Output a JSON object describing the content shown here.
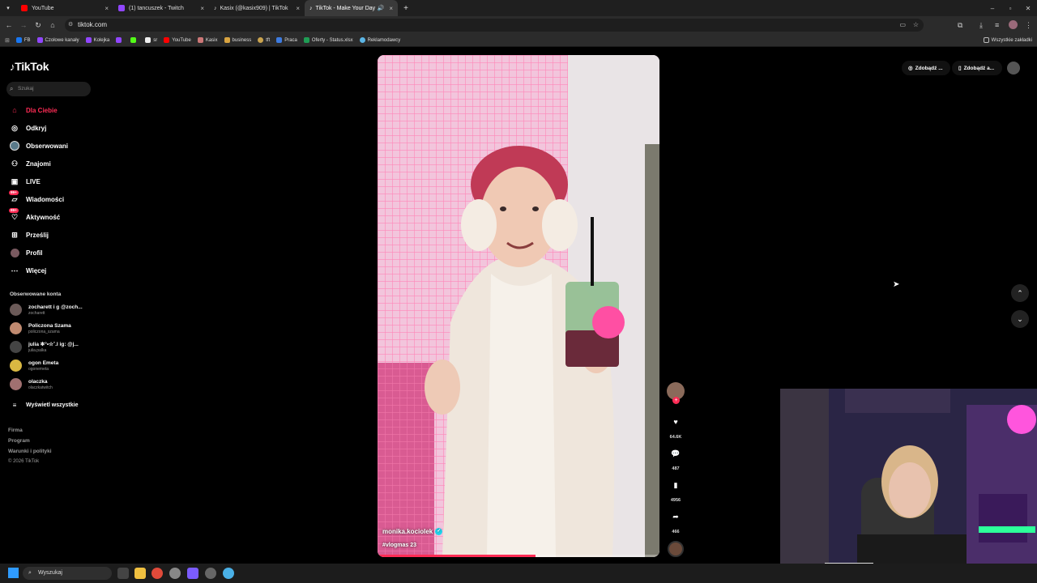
{
  "browser": {
    "tabs": [
      {
        "label": "YouTube",
        "active": false
      },
      {
        "label": "(1) tancuszek - Twitch",
        "active": false
      },
      {
        "label": "Kasix (@kasix909) | TikTok",
        "active": false
      },
      {
        "label": "TikTok - Make Your Day",
        "active": true
      }
    ],
    "url": "tiktok.com",
    "bookmarks": [
      "FB",
      "Czołowe kanały",
      "Kolejka",
      "",
      "",
      "sr",
      "YouTube",
      "Kasix",
      "business",
      "tft",
      "Praca",
      "Oferty - Status.xlsx",
      "Reklamodawcy"
    ],
    "bookmarks_folder": "Wszystkie zakładki"
  },
  "sidebar": {
    "logo": "TikTok",
    "search_placeholder": "Szukaj",
    "nav": [
      {
        "label": "Dla Ciebie",
        "icon": "home-icon",
        "active": true
      },
      {
        "label": "Odkryj",
        "icon": "compass-icon"
      },
      {
        "label": "Obserwowani",
        "icon": "following-icon"
      },
      {
        "label": "Znajomi",
        "icon": "friends-icon"
      },
      {
        "label": "LIVE",
        "icon": "live-icon"
      },
      {
        "label": "Wiadomości",
        "icon": "messages-icon",
        "badge": "99+"
      },
      {
        "label": "Aktywność",
        "icon": "activity-icon",
        "badge": "99+"
      },
      {
        "label": "Prześlij",
        "icon": "upload-icon"
      },
      {
        "label": "Profil",
        "icon": "profile-icon"
      },
      {
        "label": "Więcej",
        "icon": "more-icon"
      }
    ],
    "followed_title": "Obserwowane konta",
    "followed": [
      {
        "name": "zocharett i g @zoch...",
        "handle": "zocharett"
      },
      {
        "name": "Policzona Szama",
        "handle": "policzona_szama"
      },
      {
        "name": "julia ✻°•☆˚.l ig: @j...",
        "handle": "julia.palka"
      },
      {
        "name": "ogon Emeta",
        "handle": "ogonemeta"
      },
      {
        "name": "olaczka",
        "handle": "olaczkatwitch"
      }
    ],
    "see_all": "Wyświetl wszystkie",
    "footer": [
      "Firma",
      "Program",
      "Warunki i polityki",
      "© 2026 TikTok"
    ]
  },
  "video": {
    "author": "monika.kociolek",
    "caption": "#vlogmas 23",
    "progress": 0.56
  },
  "actions": {
    "likes": "64.6K",
    "comments": "487",
    "saves": "4956",
    "shares": "466"
  },
  "topright": {
    "btn1": "Zdobądź ...",
    "btn2": "Zdobądź a..."
  },
  "taskbar": {
    "search": "Wyszukaj"
  },
  "colors": {
    "accent": "#fe2c55",
    "verified": "#20d5ec"
  }
}
